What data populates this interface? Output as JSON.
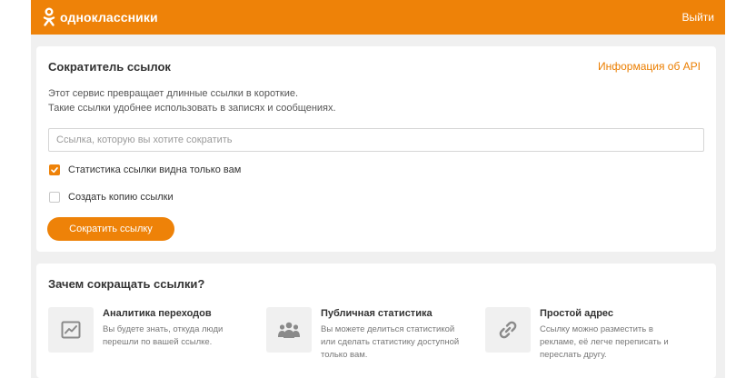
{
  "header": {
    "brand": "одноклассники",
    "logout": "Выйти",
    "brand_color": "#ee8208"
  },
  "shortener": {
    "title": "Сократитель ссылок",
    "api_link": "Информация об API",
    "desc_line1": "Этот сервис превращает длинные ссылки в короткие.",
    "desc_line2": "Такие ссылки удобнее использовать в записях и сообщениях.",
    "input_placeholder": "Ссылка, которую вы хотите сократить",
    "input_value": "",
    "checkboxes": [
      {
        "label": "Статистика ссылки видна только вам",
        "checked": true
      },
      {
        "label": "Создать копию ссылки",
        "checked": false
      }
    ],
    "button": "Сократить ссылку"
  },
  "why": {
    "title": "Зачем сокращать ссылки?",
    "features": [
      {
        "icon": "chart-icon",
        "title": "Аналитика переходов",
        "text": "Вы будете знать, откуда люди перешли по вашей ссылке."
      },
      {
        "icon": "people-icon",
        "title": "Публичная статистика",
        "text": "Вы можете делиться статистикой или сделать статистику доступной только вам."
      },
      {
        "icon": "link-icon",
        "title": "Простой адрес",
        "text": "Ссылку можно разместить в рекламе, её легче переписать и переслать другу."
      }
    ]
  }
}
